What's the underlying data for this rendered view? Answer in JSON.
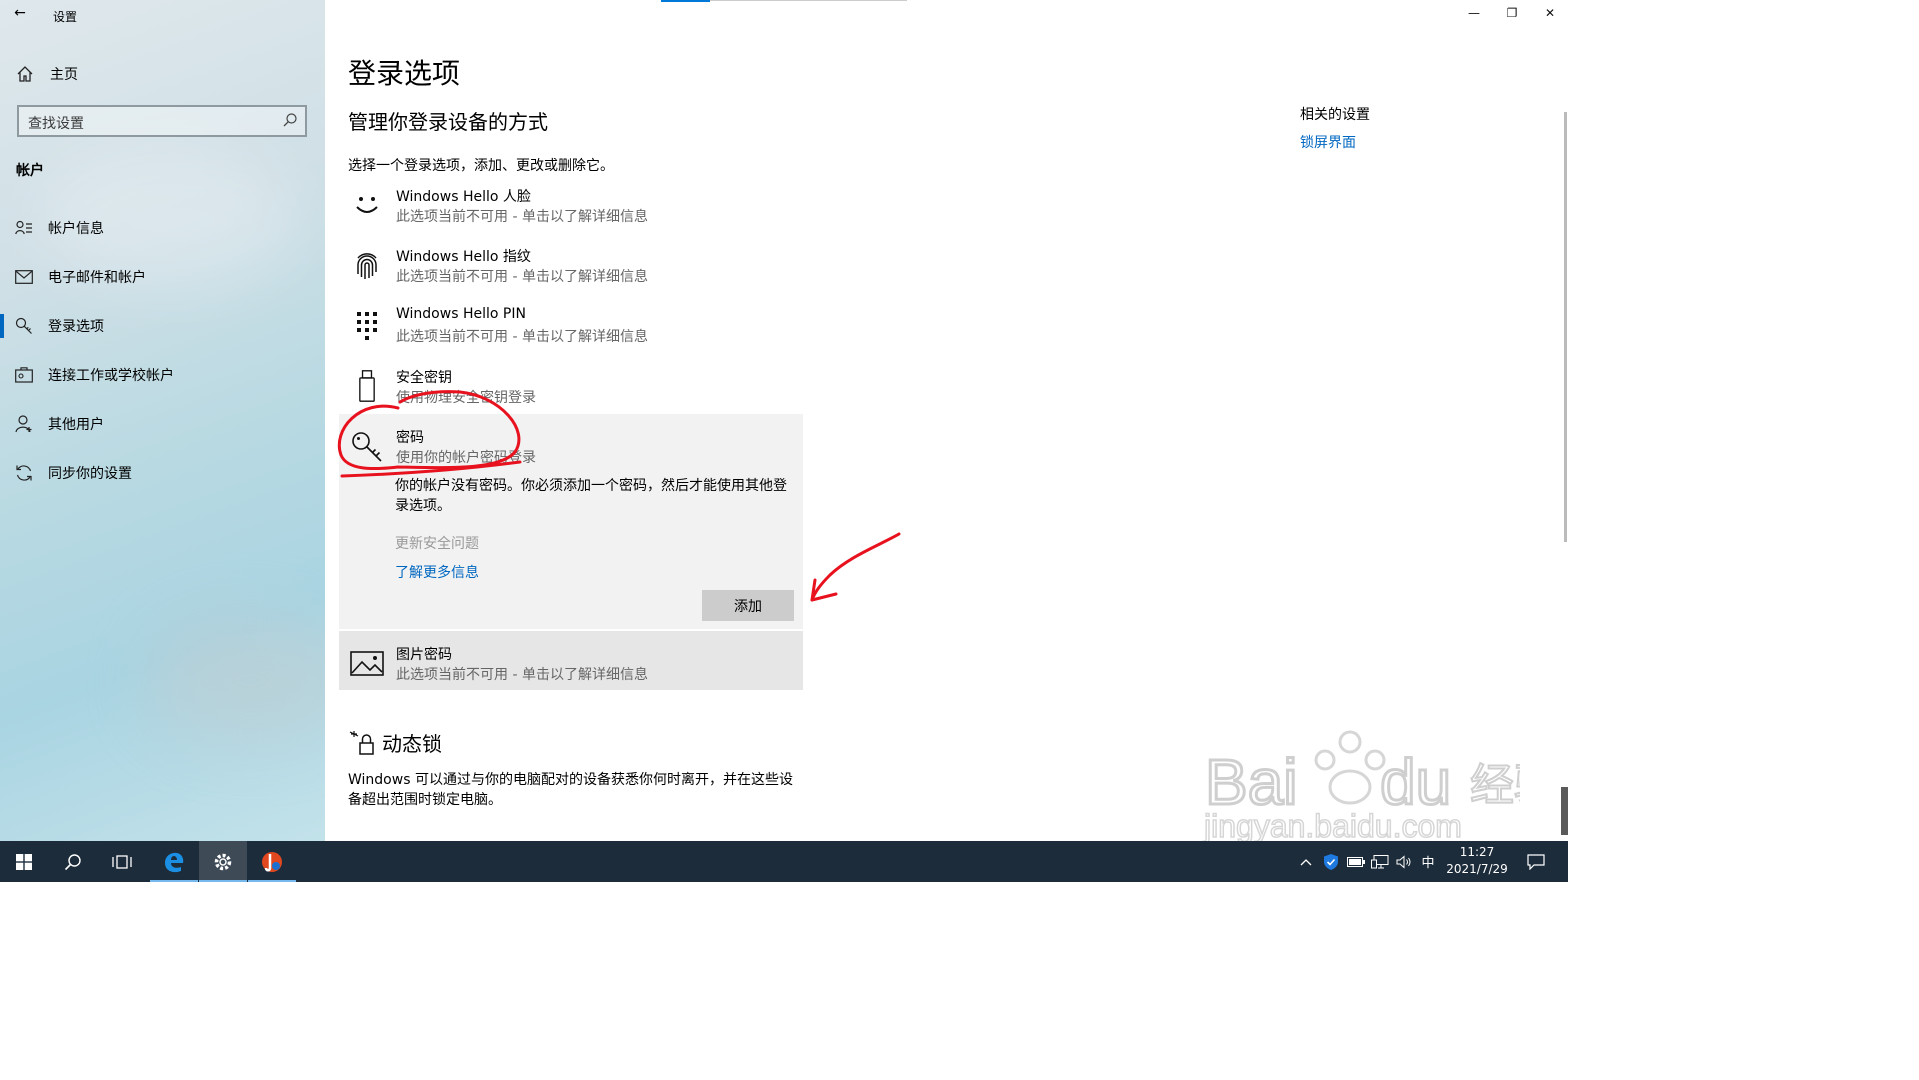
{
  "window": {
    "title": "设置",
    "controls": [
      "minimize",
      "restore",
      "close"
    ]
  },
  "sidebar": {
    "home_label": "主页",
    "search_placeholder": "查找设置",
    "section_title": "帐户",
    "items": [
      {
        "label": "帐户信息",
        "icon": "account-info-icon"
      },
      {
        "label": "电子邮件和帐户",
        "icon": "mail-icon"
      },
      {
        "label": "登录选项",
        "icon": "key-icon",
        "active": true
      },
      {
        "label": "连接工作或学校帐户",
        "icon": "briefcase-icon"
      },
      {
        "label": "其他用户",
        "icon": "person-icon"
      },
      {
        "label": "同步你的设置",
        "icon": "sync-icon"
      }
    ]
  },
  "main": {
    "title": "登录选项",
    "subtitle": "管理你登录设备的方式",
    "intro": "选择一个登录选项，添加、更改或删除它。",
    "options": [
      {
        "title": "Windows Hello 人脸",
        "subtitle": "此选项当前不可用 - 单击以了解详细信息",
        "icon": "face-icon"
      },
      {
        "title": "Windows Hello 指纹",
        "subtitle": "此选项当前不可用 - 单击以了解详细信息",
        "icon": "fingerprint-icon"
      },
      {
        "title": "Windows Hello PIN",
        "subtitle": "此选项当前不可用 - 单击以了解详细信息",
        "icon": "pin-keypad-icon"
      },
      {
        "title": "安全密钥",
        "subtitle": "使用物理安全密钥登录",
        "icon": "usb-key-icon"
      },
      {
        "title": "密码",
        "subtitle": "使用你的帐户密码登录",
        "icon": "key-icon"
      },
      {
        "title": "图片密码",
        "subtitle": "此选项当前不可用 - 单击以了解详细信息",
        "icon": "picture-icon"
      }
    ],
    "password_panel": {
      "message": "你的帐户没有密码。你必须添加一个密码，然后才能使用其他登录选项。",
      "update_security": "更新安全问题",
      "learn_more": "了解更多信息",
      "add_button": "添加"
    },
    "dynamic_lock": {
      "title": "动态锁",
      "description": "Windows 可以通过与你的电脑配对的设备获悉你何时离开，并在这些设备超出范围时锁定电脑。"
    },
    "related": {
      "title": "相关的设置",
      "link": "锁屏界面"
    }
  },
  "taskbar": {
    "apps": [
      "start-icon",
      "search-icon",
      "task-view-icon",
      "edge-icon",
      "settings-icon",
      "app-icon"
    ],
    "ime": "中",
    "time": "11:27",
    "date": "2021/7/29"
  },
  "watermark": {
    "brand": "Bai du 经验",
    "url": "jingyan.baidu.com"
  },
  "colors": {
    "accent": "#0067c0",
    "annotation": "#e8121f",
    "taskbar": "#1d2c3a"
  }
}
